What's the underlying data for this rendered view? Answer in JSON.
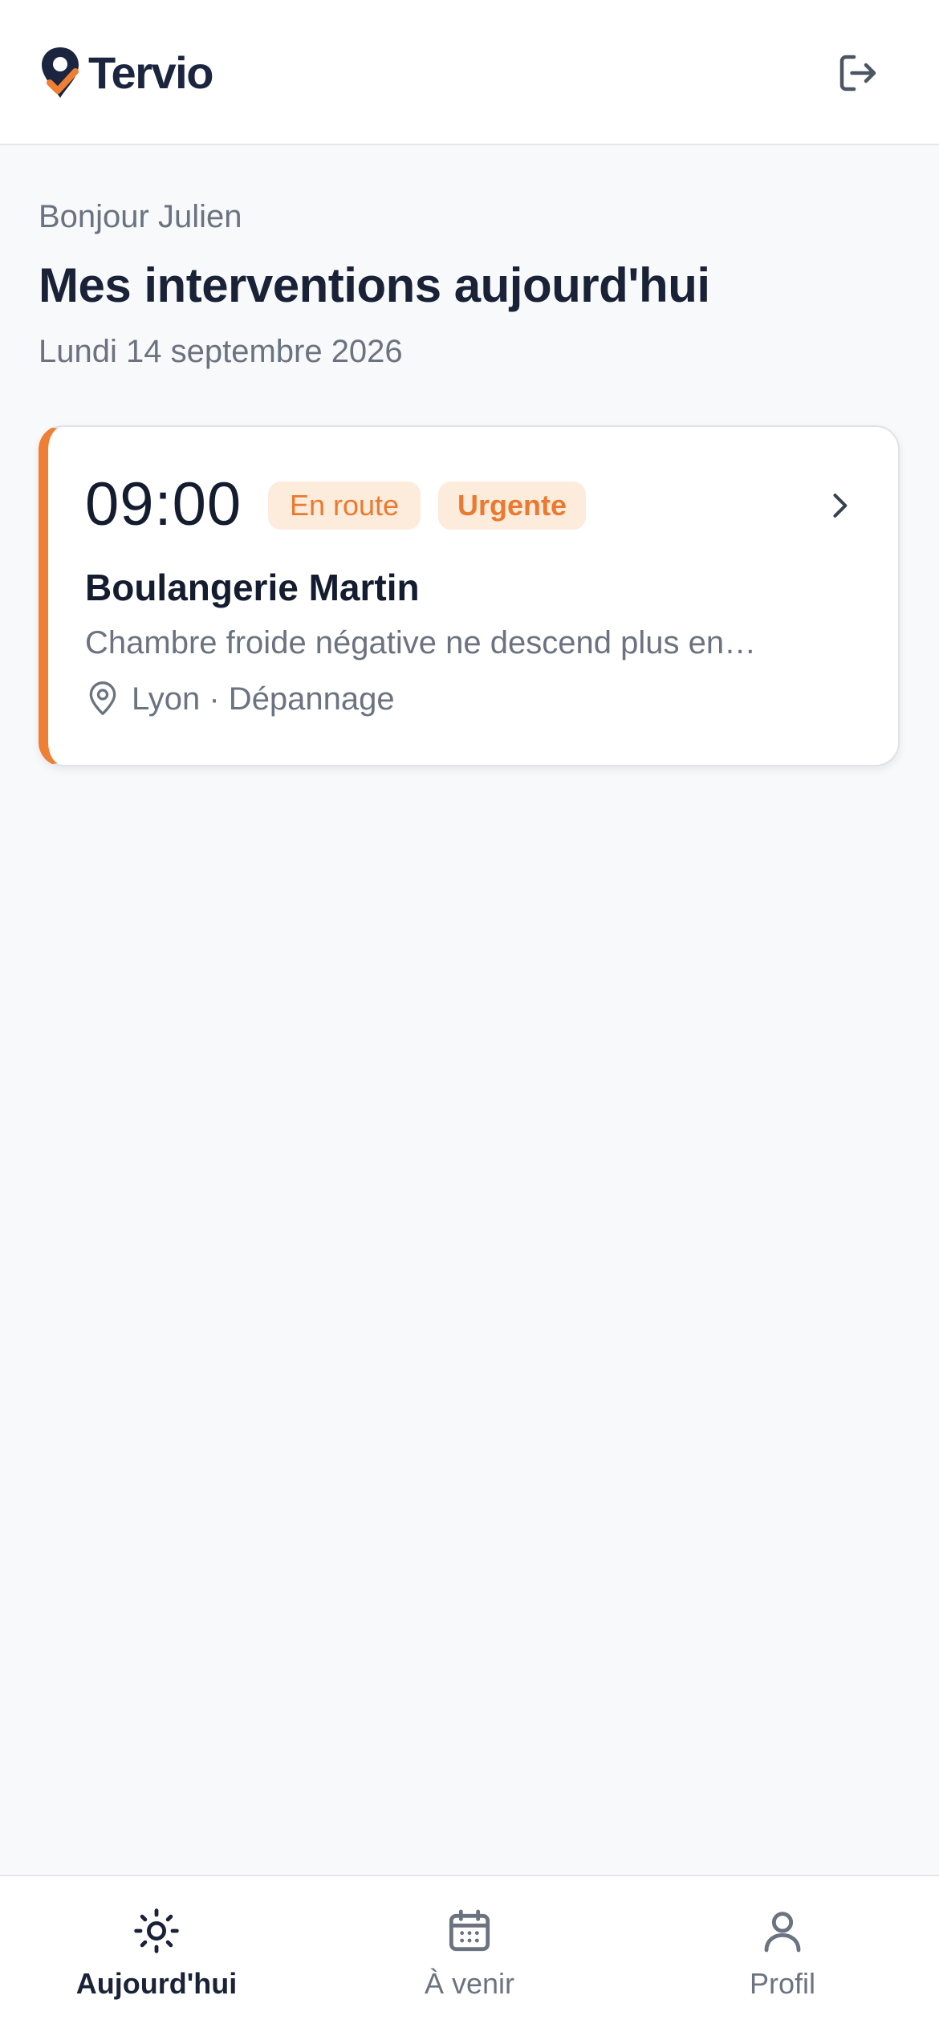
{
  "brand": {
    "name": "Tervio",
    "accent": "#ef7f33",
    "ink": "#1b2540"
  },
  "header": {
    "logout_icon": "logout-icon"
  },
  "greeting": "Bonjour Julien",
  "page_title": "Mes interventions aujourd'hui",
  "date": "Lundi 14 septembre 2026",
  "interventions": [
    {
      "time": "09:00",
      "status": "En route",
      "priority": "Urgente",
      "client": "Boulangerie Martin",
      "description": "Chambre froide négative ne descend plus en…",
      "location": "Lyon · Dépannage",
      "accent_color": "#ef7f33"
    }
  ],
  "nav": {
    "items": [
      {
        "label": "Aujourd'hui",
        "icon": "sun-icon",
        "active": true
      },
      {
        "label": "À venir",
        "icon": "calendar-icon",
        "active": false
      },
      {
        "label": "Profil",
        "icon": "user-icon",
        "active": false
      }
    ]
  }
}
